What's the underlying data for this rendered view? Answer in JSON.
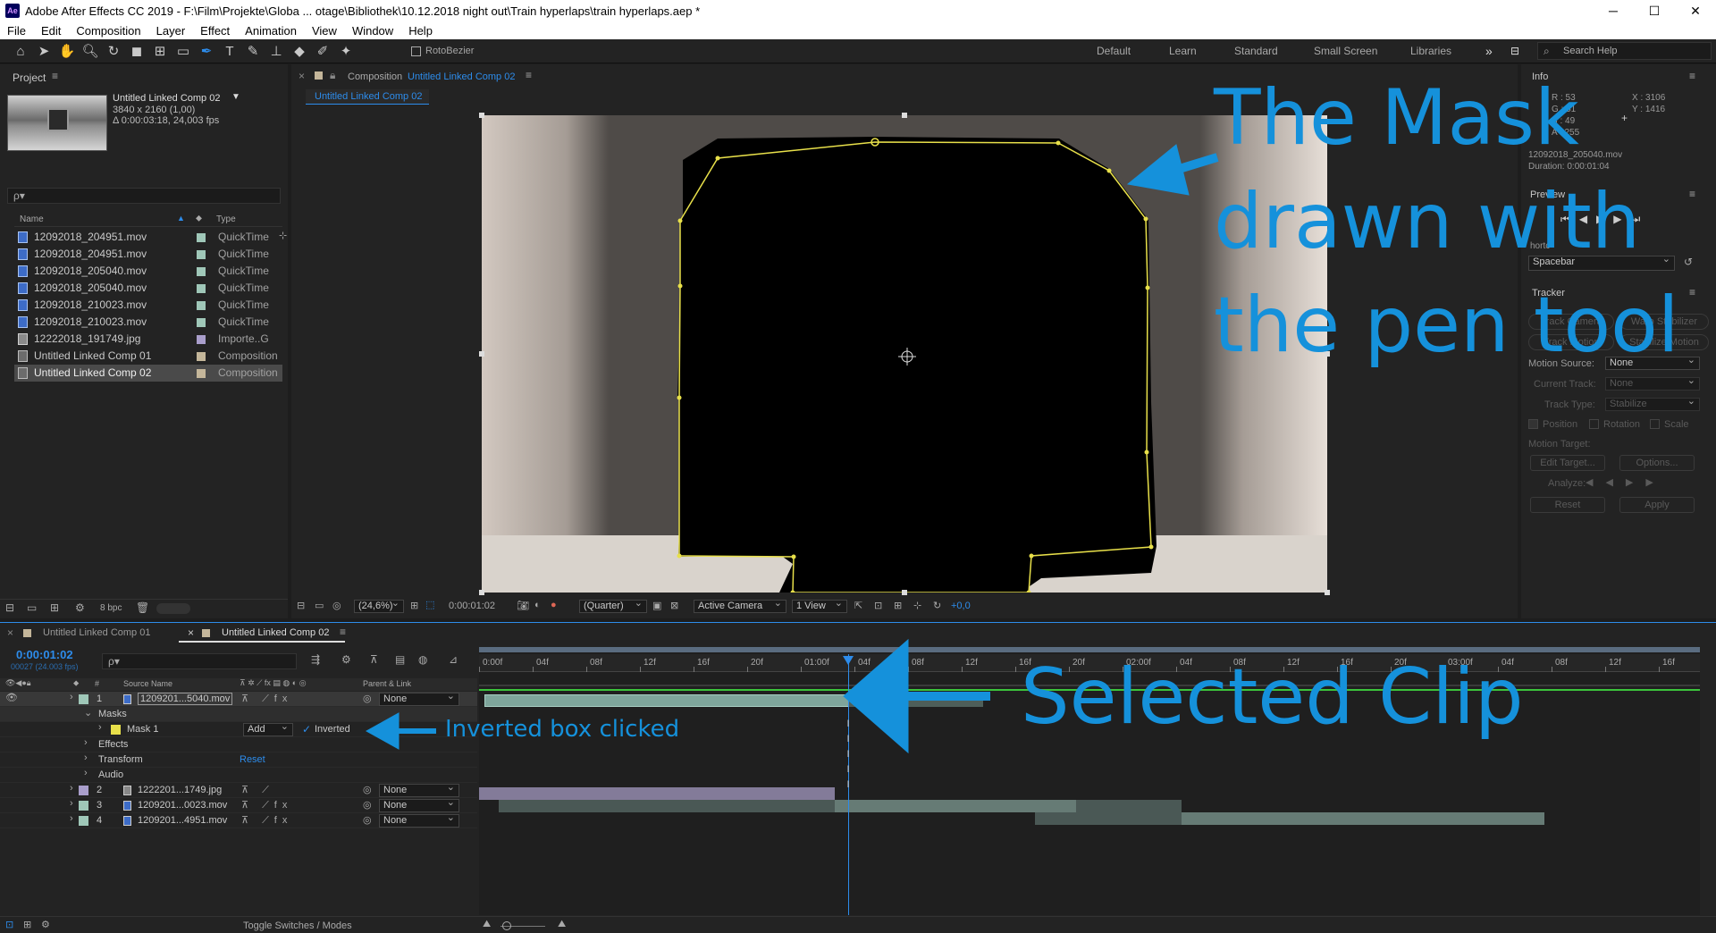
{
  "window": {
    "title": "Adobe After Effects CC 2019 - F:\\Film\\Projekte\\Globa ... otage\\Bibliothek\\10.12.2018 night out\\Train hyperlaps\\train hyperlaps.aep *",
    "minimize": "─",
    "maximize": "☐",
    "close": "✕"
  },
  "menu": [
    "File",
    "Edit",
    "Composition",
    "Layer",
    "Effect",
    "Animation",
    "View",
    "Window",
    "Help"
  ],
  "toolbar": {
    "rotobezier": "RotoBezier",
    "workspaces": [
      "Default",
      "Learn",
      "Standard",
      "Small Screen",
      "Libraries"
    ],
    "more": "»",
    "search_placeholder": "Search Help"
  },
  "project": {
    "title": "Project",
    "comp_name": "Untitled Linked Comp 02",
    "comp_res": "3840 x 2160 (1,00)",
    "comp_dur": "Δ 0:00:03:18, 24,003 fps",
    "search_placeholder": "ρ▾",
    "col_name": "Name",
    "col_type": "Type",
    "items": [
      {
        "name": "12092018_204951.mov",
        "type": "QuickTime",
        "kind": "mov",
        "color": "#9fc7b8"
      },
      {
        "name": "12092018_204951.mov",
        "type": "QuickTime",
        "kind": "mov",
        "color": "#9fc7b8"
      },
      {
        "name": "12092018_205040.mov",
        "type": "QuickTime",
        "kind": "mov",
        "color": "#9fc7b8"
      },
      {
        "name": "12092018_205040.mov",
        "type": "QuickTime",
        "kind": "mov",
        "color": "#9fc7b8"
      },
      {
        "name": "12092018_210023.mov",
        "type": "QuickTime",
        "kind": "mov",
        "color": "#9fc7b8"
      },
      {
        "name": "12092018_210023.mov",
        "type": "QuickTime",
        "kind": "mov",
        "color": "#9fc7b8"
      },
      {
        "name": "12222018_191749.jpg",
        "type": "Importe..G",
        "kind": "img",
        "color": "#a99ecb"
      },
      {
        "name": "Untitled Linked Comp 01",
        "type": "Composition",
        "kind": "comp",
        "color": "#c4b69a"
      },
      {
        "name": "Untitled Linked Comp 02",
        "type": "Composition",
        "kind": "comp",
        "color": "#c4b69a"
      }
    ],
    "bpc": "8 bpc"
  },
  "composition": {
    "panel_label": "Composition",
    "panel_comp": "Untitled Linked Comp 02",
    "tab": "Untitled Linked Comp 02",
    "zoom": "(24,6%)",
    "time": "0:00:01:02",
    "resolution": "(Quarter)",
    "camera": "Active Camera",
    "views": "1 View",
    "exposure": "+0,0"
  },
  "info": {
    "title": "Info",
    "r": "R : 53",
    "g": "G : 51",
    "b": "B : 49",
    "a": "A : 255",
    "x": "X : 3106",
    "y": "Y : 1416",
    "file": "12092018_205040.mov",
    "duration": "Duration: 0:00:01:04"
  },
  "preview": {
    "title": "Preview",
    "shortcut_label": "hortc",
    "shortcut_value": "Spacebar"
  },
  "tracker": {
    "title": "Tracker",
    "btn_track_camera": "Track Camera",
    "btn_warp": "Warp Stabilizer",
    "btn_track_motion": "Track Motion",
    "btn_stabilize": "Stabilize Motion",
    "motion_source_label": "Motion Source:",
    "motion_source": "None",
    "current_track_label": "Current Track:",
    "current_track": "None",
    "track_type_label": "Track Type:",
    "track_type": "Stabilize",
    "position": "Position",
    "rotation": "Rotation",
    "scale": "Scale",
    "motion_target_label": "Motion Target:",
    "edit_target": "Edit Target...",
    "options": "Options...",
    "analyze": "Analyze:",
    "reset": "Reset",
    "apply": "Apply"
  },
  "timeline": {
    "tab1": "Untitled Linked Comp 01",
    "tab2": "Untitled Linked Comp 02",
    "time": "0:00:01:02",
    "frames": "00027 (24.003 fps)",
    "search_placeholder": "ρ▾",
    "col_num": "#",
    "col_source": "Source Name",
    "col_parent": "Parent & Link",
    "ruler": [
      "0:00f",
      "04f",
      "08f",
      "12f",
      "16f",
      "20f",
      "01:00f",
      "04f",
      "08f",
      "12f",
      "16f",
      "20f",
      "02:00f",
      "04f",
      "08f",
      "12f",
      "16f",
      "20f",
      "03:00f",
      "04f",
      "08f",
      "12f",
      "16f"
    ],
    "layers": [
      {
        "num": "1",
        "name": "1209201...5040.mov",
        "color": "#9fc7b8",
        "kind": "mov",
        "parent": "None"
      },
      {
        "num": "2",
        "name": "1222201...1749.jpg",
        "color": "#a99ecb",
        "kind": "img",
        "parent": "None"
      },
      {
        "num": "3",
        "name": "1209201...0023.mov",
        "color": "#9fc7b8",
        "kind": "mov",
        "parent": "None"
      },
      {
        "num": "4",
        "name": "1209201...4951.mov",
        "color": "#9fc7b8",
        "kind": "mov",
        "parent": "None"
      }
    ],
    "masks_label": "Masks",
    "mask1_label": "Mask 1",
    "mask_mode": "Add",
    "inverted_label": "Inverted",
    "effects_label": "Effects",
    "transform_label": "Transform",
    "reset_label": "Reset",
    "audio_label": "Audio",
    "toggle_label": "Toggle Switches / Modes"
  },
  "annotations": {
    "mask_line1": "The Mask",
    "mask_line2": "drawn with",
    "mask_line3": "the pen tool",
    "selected_clip": "Selected Clip",
    "inverted_clicked": "Inverted box clicked"
  },
  "colors": {
    "accent": "#2d8ceb",
    "annotation": "#1591db",
    "mask_path": "#e8e04a"
  }
}
